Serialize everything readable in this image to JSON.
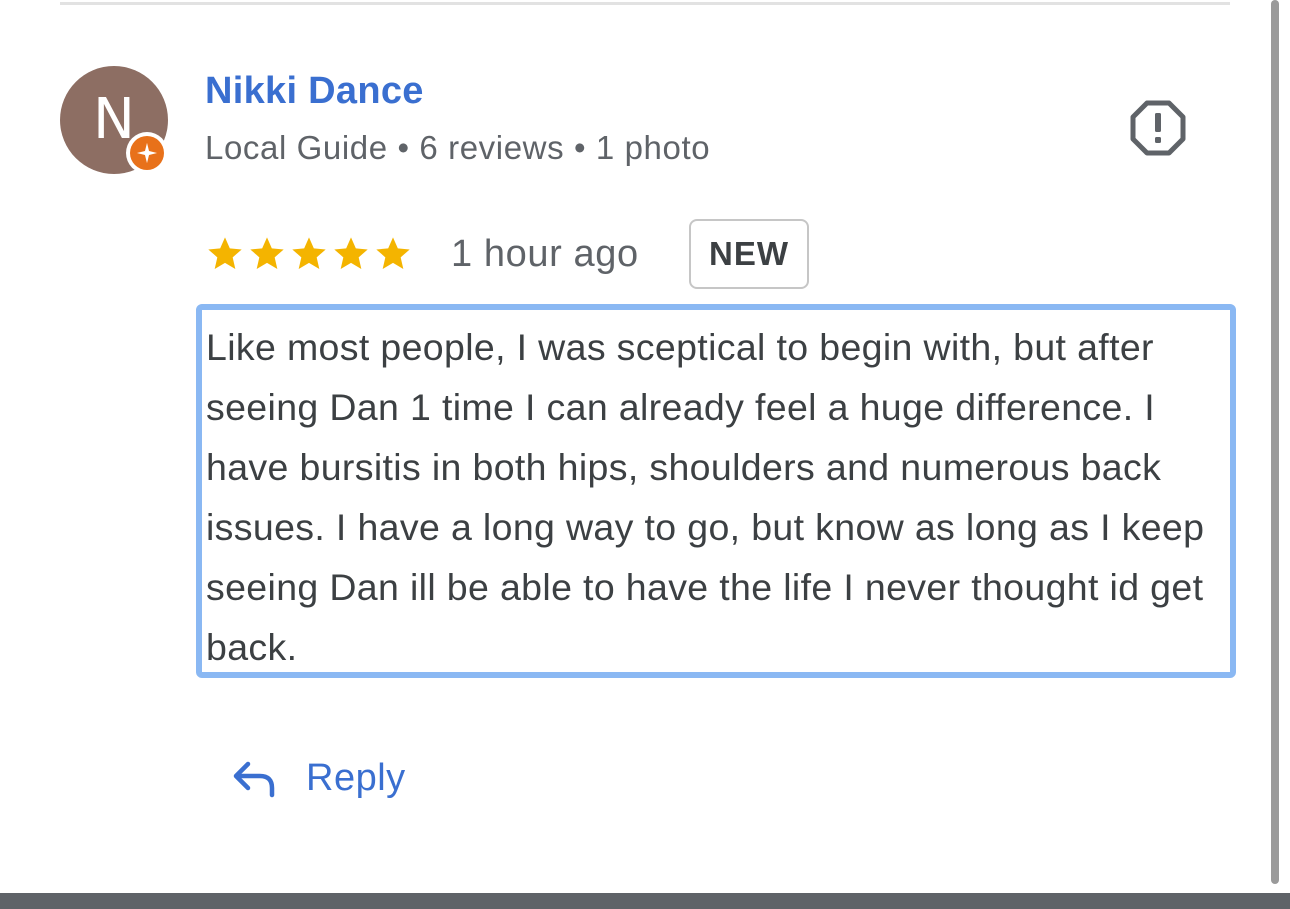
{
  "reviewer": {
    "avatar_initial": "N",
    "name": "Nikki Dance",
    "meta": "Local Guide • 6 reviews • 1 photo"
  },
  "review": {
    "rating_stars": 5,
    "time_ago": "1 hour ago",
    "badge": "NEW",
    "text": "Like most people, I was sceptical to begin with, but after seeing Dan 1 time I can already feel a huge difference. I have bursitis in both hips, shoulders and numerous back issues. I have a long way to go, but know as long as I keep seeing Dan ill be able to have the life I never thought id get back."
  },
  "actions": {
    "reply_label": "Reply",
    "report_icon": "report-flag-icon"
  },
  "colors": {
    "name_blue": "#3a6fd0",
    "star_gold": "#f4b400",
    "avatar_bg": "#8d6e63",
    "guide_badge": "#e8711a",
    "selection_border": "#8ab8f3"
  }
}
